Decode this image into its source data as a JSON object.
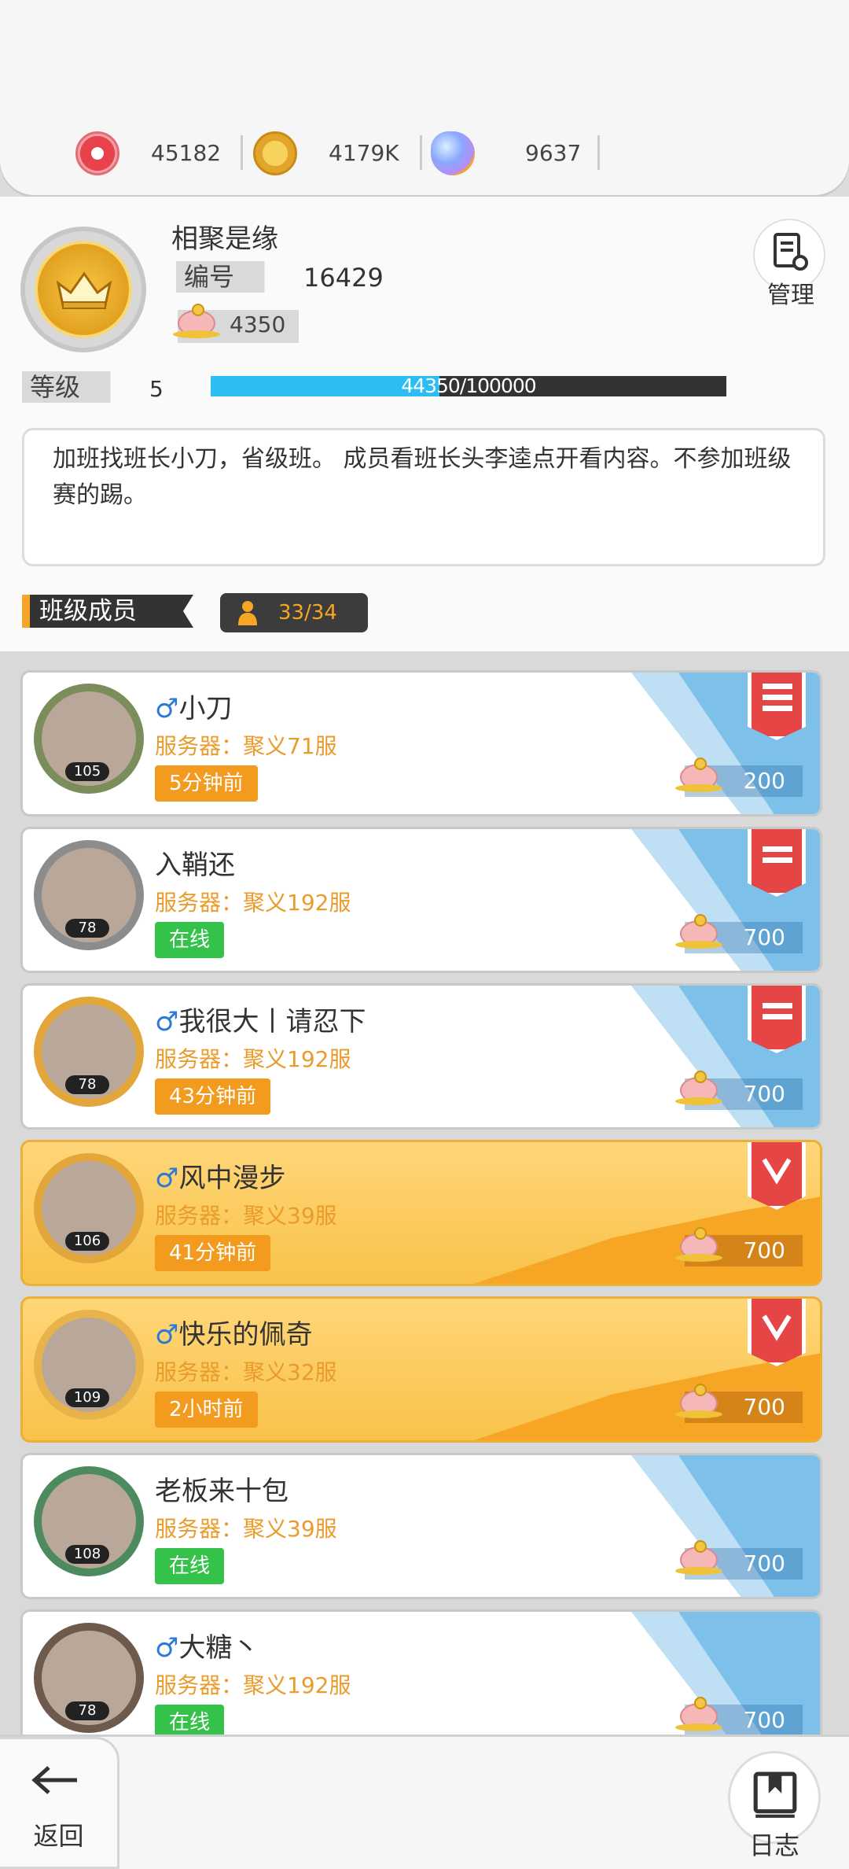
{
  "resources": [
    {
      "icon": "red-coin-icon",
      "value": "45182"
    },
    {
      "icon": "gold-coin-icon",
      "value": "4179K"
    },
    {
      "icon": "gem-pacifier-icon",
      "value": "9637"
    }
  ],
  "class": {
    "name": "相聚是缘",
    "id_label": "编号",
    "id": "16429",
    "funds": "4350",
    "level_label": "等级",
    "level": "5",
    "exp_text": "44350/100000",
    "exp_fraction": 0.4435,
    "manage_label": "管理",
    "description": "加班找班长小刀，省级班。 成员看班长头李逵点开看内容。不参加班级赛的踢。"
  },
  "members_header": {
    "label": "班级成员",
    "count": "33/34"
  },
  "members": [
    {
      "sex": "♂",
      "name": "小刀",
      "server": "服务器：聚义71服",
      "status": "5分钟前",
      "online": false,
      "points": "200",
      "level": "105",
      "gold": false,
      "badge": "leader"
    },
    {
      "sex": "",
      "name": "入鞘还",
      "server": "服务器：聚义192服",
      "status": "在线",
      "online": true,
      "points": "700",
      "level": "78",
      "gold": false,
      "badge": "officer"
    },
    {
      "sex": "♂",
      "name": "我很大丨请忍下",
      "server": "服务器：聚义192服",
      "status": "43分钟前",
      "online": false,
      "points": "700",
      "level": "78",
      "gold": false,
      "badge": "officer"
    },
    {
      "sex": "♂",
      "name": "风中漫步",
      "server": "服务器：聚义39服",
      "status": "41分钟前",
      "online": false,
      "points": "700",
      "level": "106",
      "gold": true,
      "badge": "elite"
    },
    {
      "sex": "♂",
      "name": "快乐的佩奇",
      "server": "服务器：聚义32服",
      "status": "2小时前",
      "online": false,
      "points": "700",
      "level": "109",
      "gold": true,
      "badge": "elite"
    },
    {
      "sex": "",
      "name": "老板来十包",
      "server": "服务器：聚义39服",
      "status": "在线",
      "online": true,
      "points": "700",
      "level": "108",
      "gold": false,
      "badge": "none"
    },
    {
      "sex": "♂",
      "name": "大糖丶",
      "server": "服务器：聚义192服",
      "status": "在线",
      "online": true,
      "points": "700",
      "level": "78",
      "gold": false,
      "badge": "none"
    }
  ],
  "bottom": {
    "back_label": "返回",
    "log_label": "日志"
  }
}
